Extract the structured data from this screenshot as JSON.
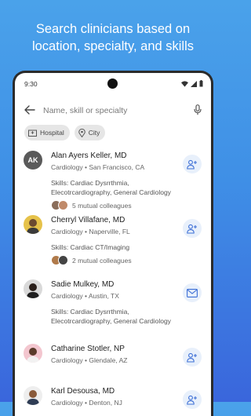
{
  "headline": {
    "line1": "Search clinicians based on",
    "line2": "location, specialty, and skills"
  },
  "status_bar": {
    "time": "9:30"
  },
  "search": {
    "placeholder": "Name, skill or specialty"
  },
  "filters": [
    {
      "label": "Hospital",
      "icon": "hospital-icon"
    },
    {
      "label": "City",
      "icon": "location-pin-icon"
    }
  ],
  "clinicians": [
    {
      "name": "Alan Ayers Keller, MD",
      "initials": "AK",
      "meta": "Cardiology • San Francisco, CA",
      "skills_line1": "Skills: Cardiac Dysrrthmia,",
      "skills_line2": "Elecotrcardiography, General Cardiology",
      "mutual": "5 mutual colleagues",
      "action": "add-connection"
    },
    {
      "name": "Cherryl Villafane, MD",
      "initials": "",
      "meta": "Cardiology • Naperville, FL",
      "skills_line1": "Skills: Cardiac CT/Imaging",
      "skills_line2": "",
      "mutual": "2 mutual colleagues",
      "action": "add-connection"
    },
    {
      "name": "Sadie Mulkey, MD",
      "initials": "",
      "meta": "Cardiology • Austin, TX",
      "skills_line1": "Skills: Cardiac Dysrrthmia,",
      "skills_line2": "Elecotrcardiography, General Cardiology",
      "mutual": "",
      "action": "message"
    },
    {
      "name": "Catharine Stotler, NP",
      "initials": "",
      "meta": "Cardiology • Glendale, AZ",
      "skills_line1": "",
      "skills_line2": "",
      "mutual": "",
      "action": "add-connection"
    },
    {
      "name": "Karl Desousa, MD",
      "initials": "",
      "meta": "Cardiology • Denton, NJ",
      "skills_line1": "",
      "skills_line2": "",
      "mutual": "",
      "action": "add-connection"
    }
  ],
  "colors": {
    "accent": "#3d6fd6",
    "background_top": "#4aa2ea",
    "background_bottom": "#3a66dc"
  }
}
